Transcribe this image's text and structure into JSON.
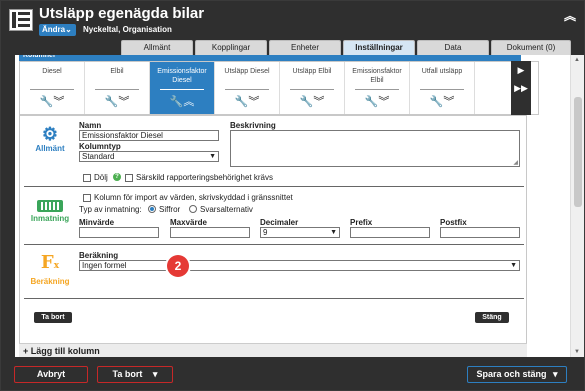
{
  "header": {
    "title": "Utsläpp egenägda bilar",
    "mode_label": "Ändra",
    "subtitle": "Nyckeltal, Organisation",
    "collapse_icon": "chevron-double-up-icon"
  },
  "tabs": [
    {
      "label": "Allmänt",
      "active": false
    },
    {
      "label": "Kopplingar",
      "active": false
    },
    {
      "label": "Enheter",
      "active": false
    },
    {
      "label": "Inställningar",
      "active": true
    },
    {
      "label": "Data",
      "active": false
    },
    {
      "label": "Dokument (0)",
      "active": false
    }
  ],
  "columns_header": "Kolumner",
  "columns": [
    {
      "label": "Diesel",
      "active": false
    },
    {
      "label": "Elbil",
      "active": false
    },
    {
      "label": "Emissionsfaktor Diesel",
      "active": true
    },
    {
      "label": "Utsläpp Diesel",
      "active": false
    },
    {
      "label": "Utsläpp Elbil",
      "active": false
    },
    {
      "label": "Emissionsfaktor Elbil",
      "active": false
    },
    {
      "label": "Utfall utsläpp",
      "active": false
    }
  ],
  "allmant": {
    "section_label": "Allmänt",
    "name_label": "Namn",
    "name_value": "Emissionsfaktor Diesel",
    "coltype_label": "Kolumntyp",
    "coltype_value": "Standard",
    "desc_label": "Beskrivning",
    "hide_label": "Dölj",
    "special_label": "Särskild rapporteringsbehörighet krävs"
  },
  "inmatning": {
    "section_label": "Inmatning",
    "import_label": "Kolumn för import av värden, skrivskyddad i gränssnittet",
    "input_type_label": "Typ av inmatning:",
    "opt_figures": "Siffror",
    "opt_alternatives": "Svarsalternativ",
    "min_label": "Minvärde",
    "max_label": "Maxvärde",
    "decimals_label": "Decimaler",
    "decimals_value": "9",
    "prefix_label": "Prefix",
    "postfix_label": "Postfix"
  },
  "berakning": {
    "section_label": "Beräkning",
    "field_label": "Beräkning",
    "field_value": "Ingen formel"
  },
  "panel_buttons": {
    "delete": "Ta bort",
    "close": "Stäng"
  },
  "add_column": "+ Lägg till kolumn",
  "annotation_badge": "2",
  "footer": {
    "cancel": "Avbryt",
    "delete": "Ta bort",
    "save_close": "Spara och stäng"
  },
  "colors": {
    "accent": "#2d7fc1",
    "dark": "#2f2f2f",
    "orange": "#f5a623",
    "green": "#3aa55a",
    "red": "#e53935"
  }
}
